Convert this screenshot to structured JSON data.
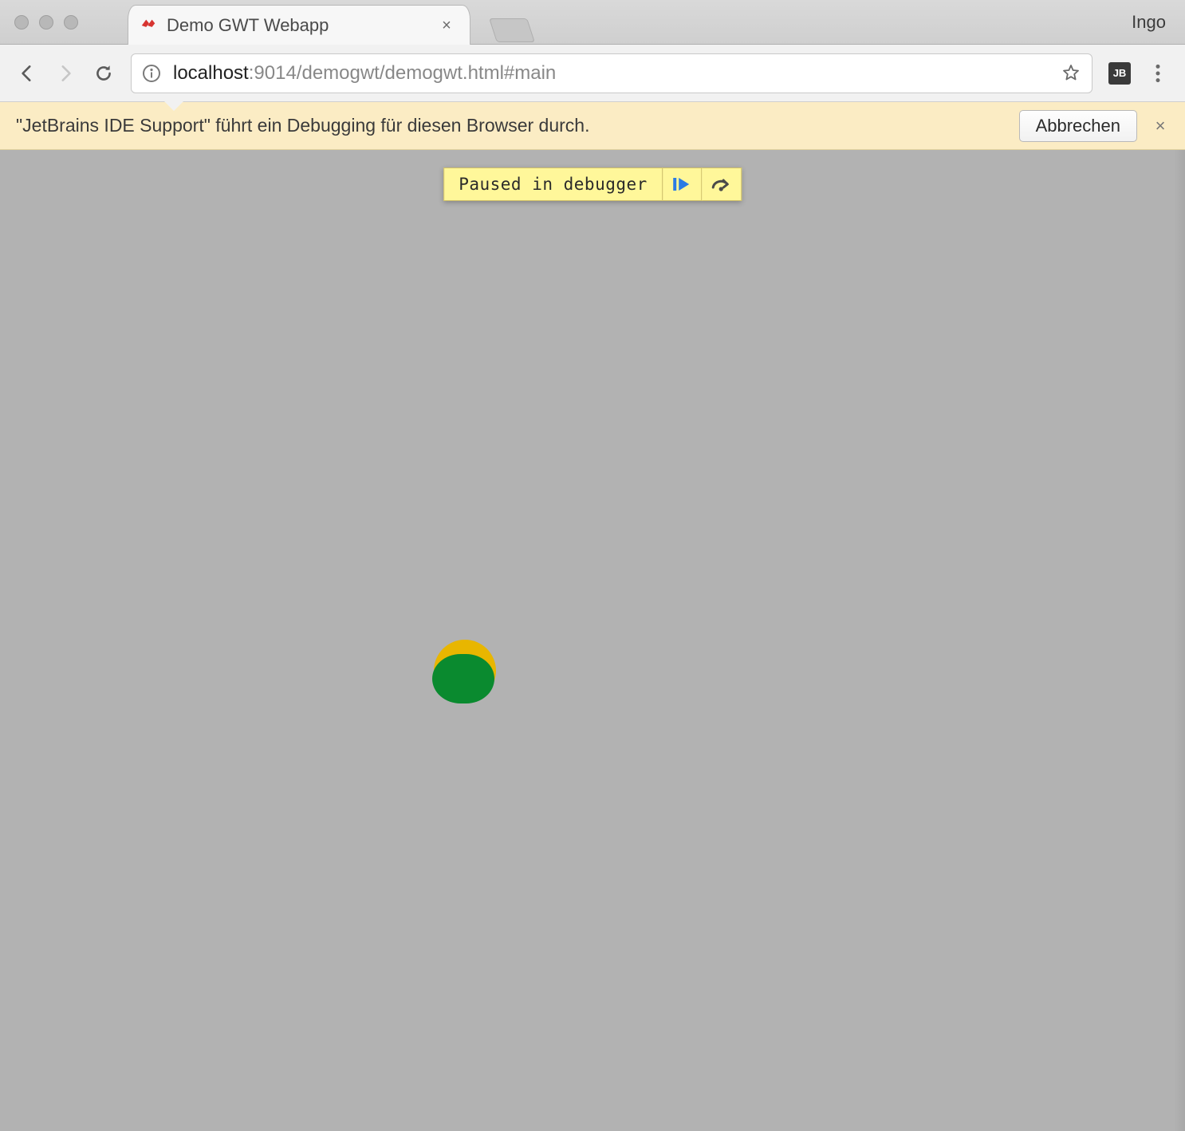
{
  "window": {
    "profile_name": "Ingo"
  },
  "tab": {
    "title": "Demo GWT Webapp",
    "favicon": "gwt-icon"
  },
  "address_bar": {
    "url_host": "localhost",
    "url_port": ":9014",
    "url_path": "/demogwt/demogwt.html#main"
  },
  "extension_badge": {
    "label": "JB"
  },
  "infobar": {
    "text": "\"JetBrains IDE Support\" führt ein Debugging für diesen Browser durch.",
    "cancel_label": "Abbrechen"
  },
  "debugger_overlay": {
    "message": "Paused in debugger"
  }
}
